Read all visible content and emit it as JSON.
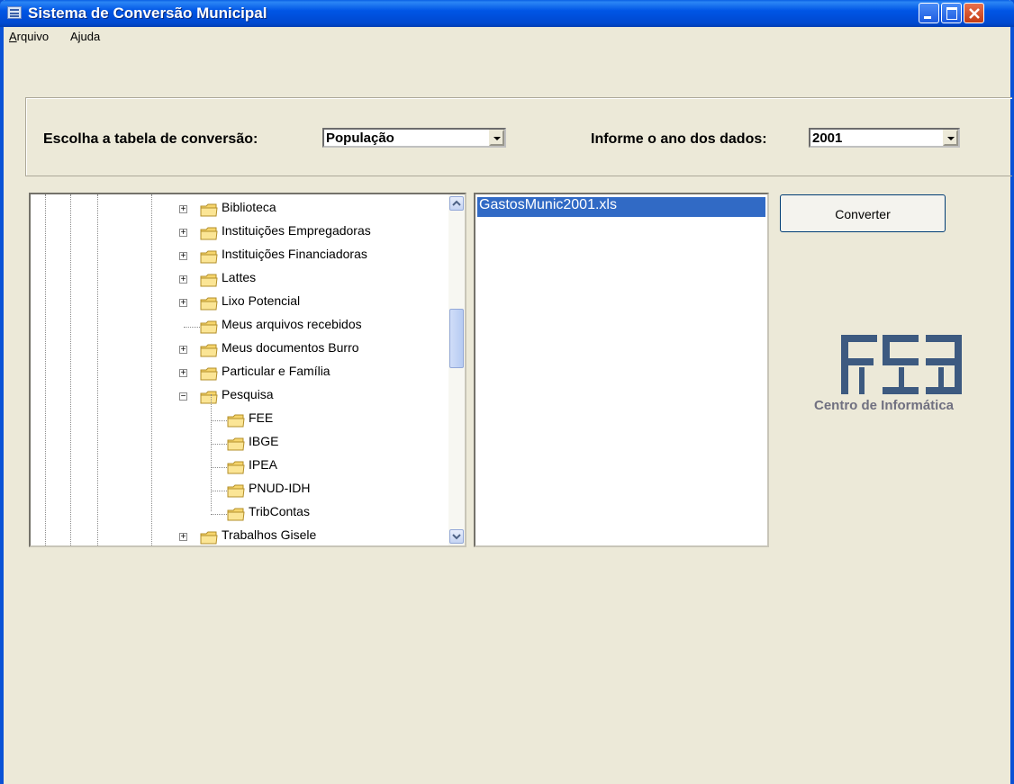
{
  "window": {
    "title": "Sistema de Conversão Municipal"
  },
  "menu": {
    "items": [
      {
        "label": "Arquivo",
        "underline": "A",
        "rest": "rquivo"
      },
      {
        "label": "Ajuda",
        "underline": "",
        "rest": "Ajuda"
      }
    ]
  },
  "form": {
    "table_label": "Escolha a tabela de conversão:",
    "table_value": "População",
    "year_label": "Informe o ano dos dados:",
    "year_value": "2001"
  },
  "tree": {
    "items": [
      {
        "label": "Biblioteca",
        "expander": "+"
      },
      {
        "label": "Instituições Empregadoras",
        "expander": "+"
      },
      {
        "label": "Instituições Financiadoras",
        "expander": "+"
      },
      {
        "label": "Lattes",
        "expander": "+"
      },
      {
        "label": "Lixo Potencial",
        "expander": "+"
      },
      {
        "label": "Meus arquivos recebidos",
        "expander": ""
      },
      {
        "label": "Meus documentos Burro",
        "expander": "+"
      },
      {
        "label": "Particular e Família",
        "expander": "+"
      },
      {
        "label": "Pesquisa",
        "expander": "−"
      },
      {
        "label": "FEE",
        "expander": ""
      },
      {
        "label": "IBGE",
        "expander": ""
      },
      {
        "label": "IPEA",
        "expander": ""
      },
      {
        "label": "PNUD-IDH",
        "expander": ""
      },
      {
        "label": "TribContas",
        "expander": ""
      },
      {
        "label": "Trabalhos Gisele",
        "expander": "+"
      }
    ]
  },
  "files": {
    "selected": "GastosMunic2001.xls"
  },
  "actions": {
    "convert_label": "Converter"
  },
  "logo": {
    "caption": "Centro de Informática",
    "color": "#3d5a80"
  }
}
